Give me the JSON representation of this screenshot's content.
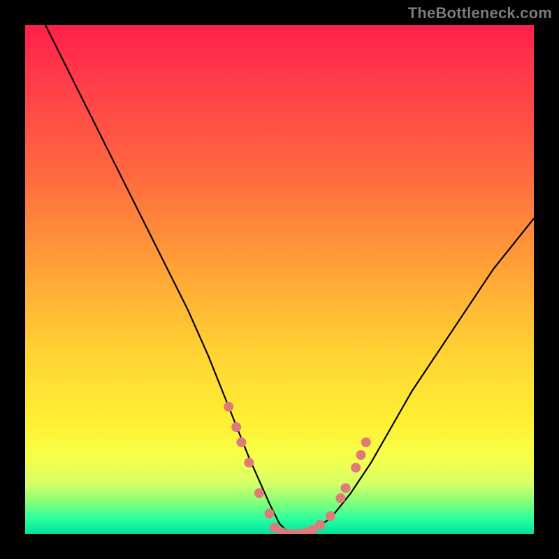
{
  "watermark": "TheBottleneck.com",
  "chart_data": {
    "type": "line",
    "title": "",
    "xlabel": "",
    "ylabel": "",
    "xlim": [
      0,
      100
    ],
    "ylim": [
      0,
      100
    ],
    "grid": false,
    "legend": false,
    "series": [
      {
        "name": "bottleneck-curve",
        "color": "#000000",
        "x": [
          0,
          4,
          8,
          12,
          16,
          20,
          24,
          28,
          32,
          36,
          40,
          44,
          48,
          50,
          52,
          54,
          56,
          60,
          64,
          68,
          72,
          76,
          80,
          84,
          88,
          92,
          96,
          100
        ],
        "y": [
          108,
          100,
          92,
          84,
          76,
          68,
          60,
          52,
          44,
          35,
          25,
          15,
          6,
          2,
          0,
          0,
          0.5,
          3,
          8,
          14,
          21,
          28,
          34,
          40,
          46,
          52,
          57,
          62
        ]
      }
    ],
    "markers": [
      {
        "name": "left-cluster",
        "color": "#e07a78",
        "radius": 7,
        "points": [
          {
            "x": 40.0,
            "y": 25
          },
          {
            "x": 41.5,
            "y": 21
          },
          {
            "x": 42.5,
            "y": 18
          },
          {
            "x": 44.0,
            "y": 14
          },
          {
            "x": 46.0,
            "y": 8
          },
          {
            "x": 48.0,
            "y": 4
          }
        ]
      },
      {
        "name": "valley-cluster",
        "color": "#e07a78",
        "radius": 7,
        "points": [
          {
            "x": 49.0,
            "y": 1.2
          },
          {
            "x": 50.5,
            "y": 0.3
          },
          {
            "x": 52.0,
            "y": 0.0
          },
          {
            "x": 53.5,
            "y": 0.0
          },
          {
            "x": 55.0,
            "y": 0.2
          },
          {
            "x": 56.5,
            "y": 0.8
          },
          {
            "x": 58.0,
            "y": 1.8
          }
        ]
      },
      {
        "name": "right-cluster",
        "color": "#e07a78",
        "radius": 7,
        "points": [
          {
            "x": 60.0,
            "y": 3.5
          },
          {
            "x": 62.0,
            "y": 7.0
          },
          {
            "x": 63.0,
            "y": 9.0
          },
          {
            "x": 65.0,
            "y": 13.0
          },
          {
            "x": 66.0,
            "y": 15.5
          },
          {
            "x": 67.0,
            "y": 18.0
          }
        ]
      }
    ],
    "background": {
      "type": "vertical-gradient",
      "stops": [
        {
          "pos": 0,
          "color": "#ff1f4a"
        },
        {
          "pos": 10,
          "color": "#ff3a4a"
        },
        {
          "pos": 30,
          "color": "#ff6b3f"
        },
        {
          "pos": 50,
          "color": "#ffa936"
        },
        {
          "pos": 65,
          "color": "#ffd433"
        },
        {
          "pos": 78,
          "color": "#fff033"
        },
        {
          "pos": 85,
          "color": "#f6ff4a"
        },
        {
          "pos": 90,
          "color": "#d7ff66"
        },
        {
          "pos": 94,
          "color": "#7fff7a"
        },
        {
          "pos": 97,
          "color": "#2dffa0"
        },
        {
          "pos": 100,
          "color": "#00e09e"
        }
      ]
    }
  }
}
